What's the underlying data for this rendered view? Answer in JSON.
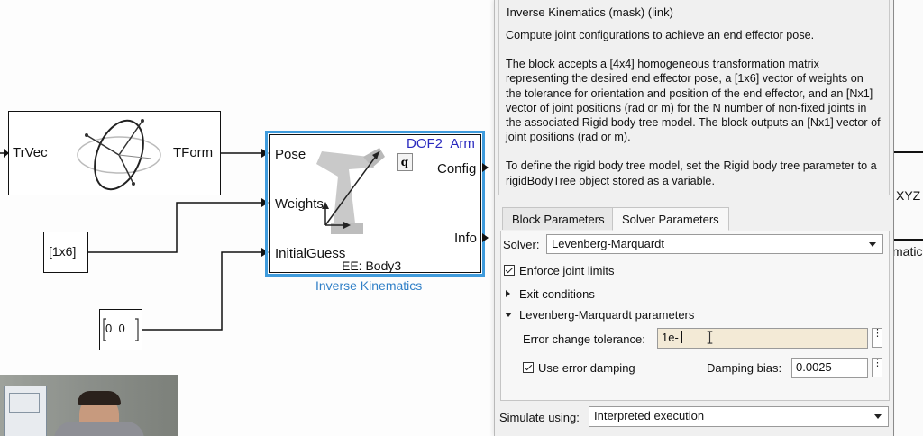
{
  "diagram": {
    "trvec_block": {
      "input_label": "TrVec",
      "output_label": "TForm"
    },
    "const_1x6": {
      "value": "[1x6]"
    },
    "const_zeros": {
      "value": "0  0"
    },
    "ik_block": {
      "port_in_1": "Pose",
      "port_in_2": "Weights",
      "port_in_3": "InitialGuess",
      "port_out_1": "Config",
      "port_out_2": "Info",
      "robot_name": "DOF2_Arm",
      "q_label": "q",
      "end_effector": "EE: Body3",
      "caption": "Inverse Kinematics"
    },
    "right_partial": {
      "top_label": "XYZ",
      "bottom_label": "matic"
    },
    "colors": {
      "ik_border": "#3f9bdc",
      "caption": "#2f7fc7",
      "robot_name": "#2a2abf"
    }
  },
  "dialog": {
    "group_title": "Inverse Kinematics (mask) (link)",
    "description": [
      "Compute joint configurations to achieve an end effector pose.",
      "The block accepts a [4x4] homogeneous transformation matrix representing the desired end effector pose, a [1x6] vector of weights on the tolerance for orientation and position of the end effector, and an [Nx1] vector of joint positions (rad or m) for the N number of non-fixed joints in the associated Rigid body tree model. The block outputs an [Nx1] vector of joint positions (rad or m).",
      "To define the rigid body tree model, set the Rigid body tree parameter to a rigidBodyTree object stored as a variable."
    ],
    "tabs": [
      {
        "label": "Block Parameters"
      },
      {
        "label": "Solver Parameters"
      }
    ],
    "solver": {
      "label": "Solver:",
      "value": "Levenberg-Marquardt"
    },
    "enforce_joint_limits": {
      "label": "Enforce joint limits",
      "checked": true
    },
    "exit_conditions": {
      "label": "Exit conditions"
    },
    "lm_params": {
      "label": "Levenberg-Marquardt parameters"
    },
    "error_change_tolerance": {
      "label": "Error change tolerance:",
      "value": "1e-"
    },
    "use_error_damping": {
      "label": "Use error damping",
      "checked": true
    },
    "damping_bias": {
      "label": "Damping bias:",
      "value": "0.0025"
    },
    "simulate_using": {
      "label": "Simulate using:",
      "value": "Interpreted execution"
    }
  },
  "icons": [
    "coordinate-transform-icon",
    "robot-arm-icon",
    "ellipsis-icon",
    "dropdown-caret-icon",
    "text-cursor-icon"
  ]
}
